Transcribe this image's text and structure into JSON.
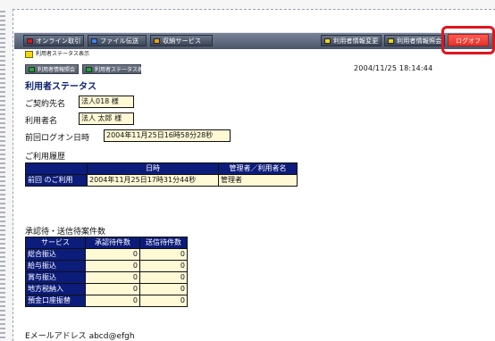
{
  "toolbar": {
    "buttons": [
      {
        "label": "オンライン取引",
        "color": "#e0151f"
      },
      {
        "label": "ファイル伝送",
        "color": "#3b82f6"
      },
      {
        "label": "収納サービス",
        "color": "#f59e0b"
      },
      {
        "label": "利用者情報変更",
        "color": "#f2d60f"
      },
      {
        "label": "利用者情報照会",
        "color": "#f2d60f"
      }
    ],
    "logout_label": "ログオフ"
  },
  "subtab": {
    "label": "利用者ステータス表示"
  },
  "second_nav": {
    "buttons": [
      {
        "label": "利用者情報照会"
      },
      {
        "label": "利用者ステータス表示"
      }
    ],
    "datetime": "2004/11/25  18:14:44"
  },
  "page_title": "利用者ステータス",
  "fields": [
    {
      "label": "ご契約先名",
      "value": "法人018 様"
    },
    {
      "label": "利用者名",
      "value": "法人 太郎 様"
    },
    {
      "label": "前回ログオン日時",
      "value": "2004年11月25日16時58分28秒"
    }
  ],
  "history": {
    "section_title": "ご利用履歴",
    "headers": [
      "",
      "日時",
      "管理者／利用者名"
    ],
    "rows": [
      {
        "kind": "前回 のご利用",
        "datetime": "2004年11月25日17時31分44秒",
        "user": "管理者"
      }
    ]
  },
  "pending": {
    "section_title": "承認待・送信待案件数",
    "headers": [
      "サービス",
      "承認待件数",
      "送信待件数"
    ],
    "rows": [
      {
        "service": "総合振込",
        "approve": "0",
        "send": "0"
      },
      {
        "service": "給与振込",
        "approve": "0",
        "send": "0"
      },
      {
        "service": "賞与振込",
        "approve": "0",
        "send": "0"
      },
      {
        "service": "地方税納入",
        "approve": "0",
        "send": "0"
      },
      {
        "service": "預金口座振替",
        "approve": "0",
        "send": "0"
      }
    ]
  },
  "email": {
    "label": "Eメールアドレス",
    "value": "abcd@efgh"
  }
}
